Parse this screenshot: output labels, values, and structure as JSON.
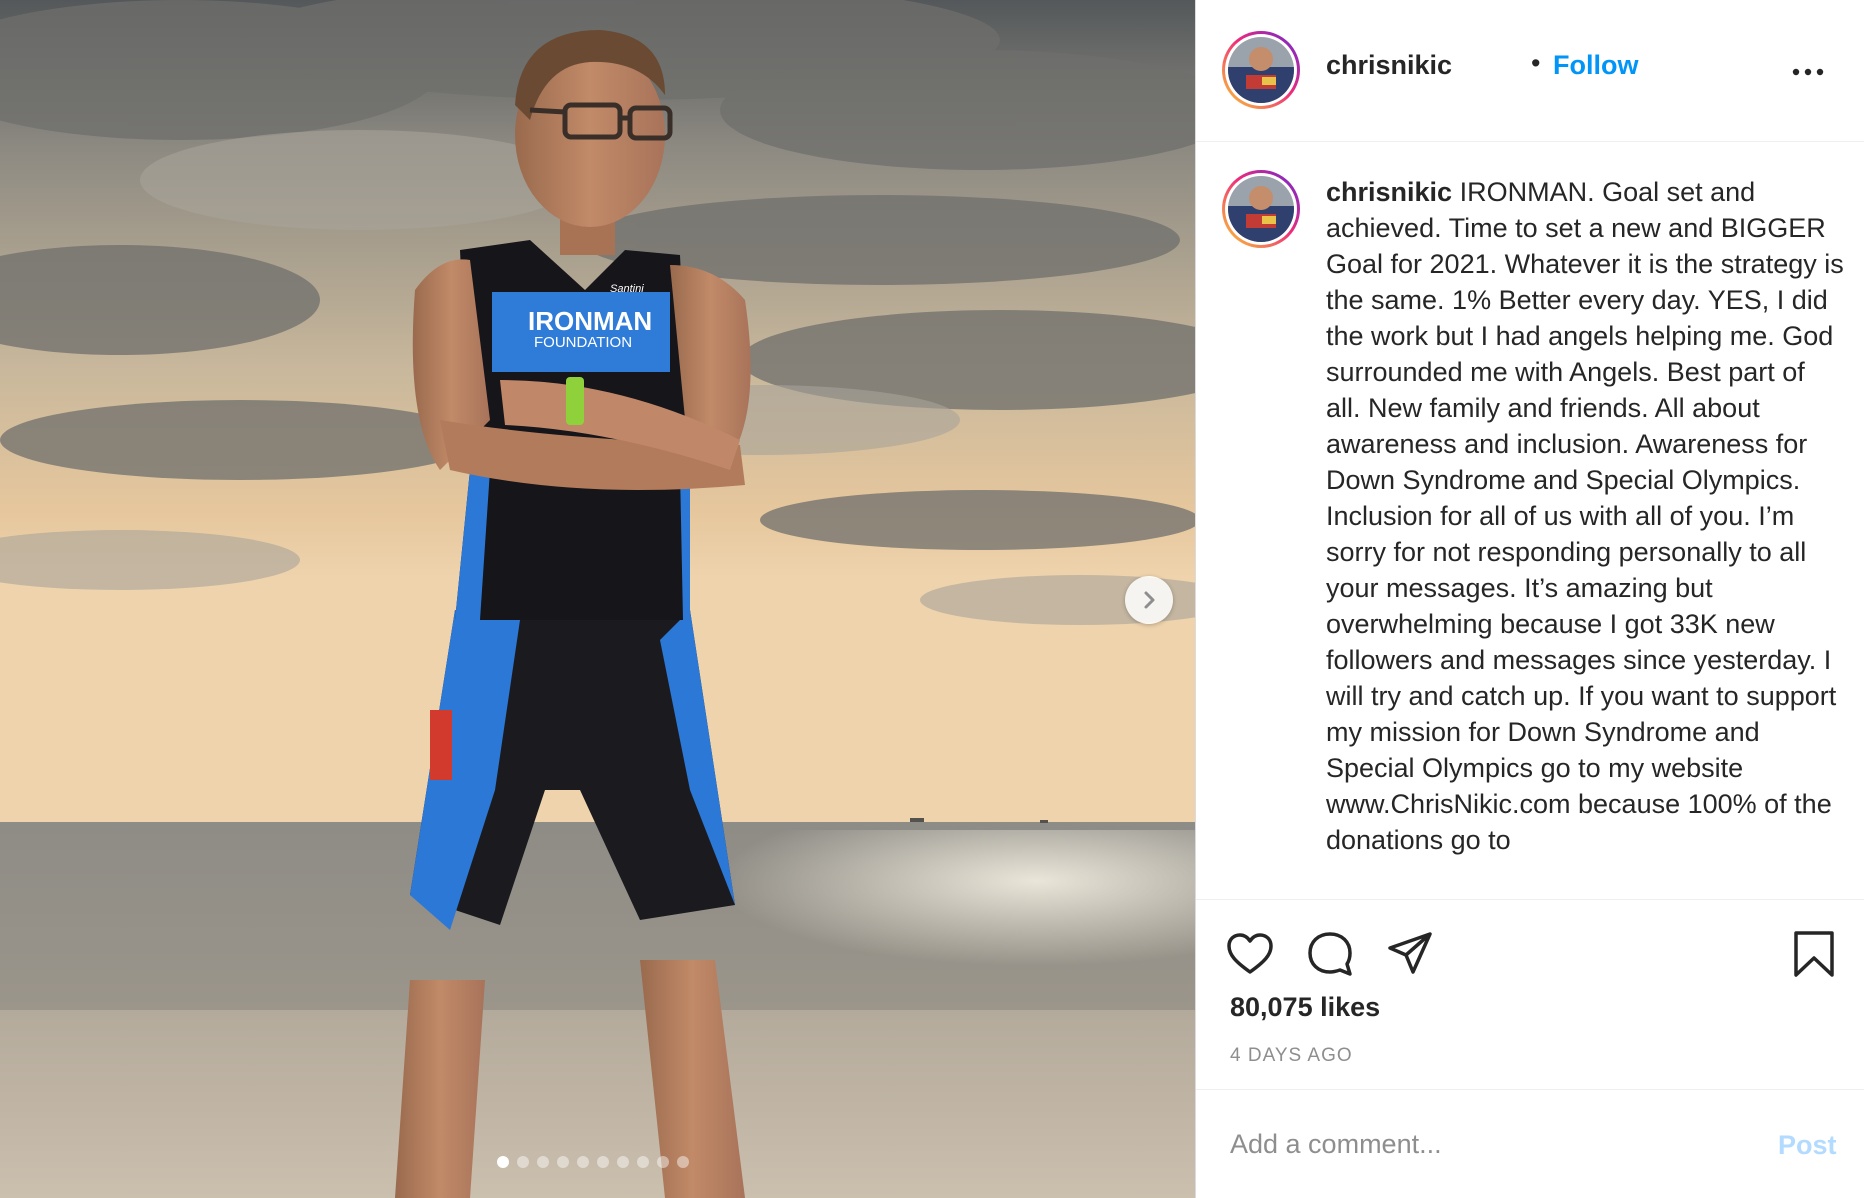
{
  "header": {
    "username": "chrisnikic",
    "separator": "•",
    "follow_label": "Follow"
  },
  "caption": {
    "username": "chrisnikic",
    "text": "IRONMAN. Goal set and achieved. Time to set a new and BIGGER Goal for 2021. Whatever it is the strategy is the same. 1% Better every day. YES, I did the work but I had angels helping me. God surrounded me with Angels. Best part of all. New family and friends. All about awareness and inclusion. Awareness for Down Syndrome and Special Olympics. Inclusion for all of us with all of you. I’m sorry for not responding personally to all your messages. It’s amazing but overwhelming because I got 33K new followers and messages since yesterday. I will try and catch up. If you want to support my mission for Down Syndrome and Special Olympics go to my website www.ChrisNikic.com because 100% of the donations go to"
  },
  "photo": {
    "jersey_brand": "IRONMAN",
    "jersey_sub": "FOUNDATION",
    "jersey_sponsor": "Santini"
  },
  "carousel": {
    "total_slides": 10,
    "active_slide": 1
  },
  "actions": {
    "likes": "80,075 likes",
    "timestamp": "4 DAYS AGO"
  },
  "comment": {
    "placeholder": "Add a comment...",
    "post_label": "Post"
  },
  "colors": {
    "link_blue": "#0095f6",
    "post_disabled": "#b3dbff",
    "muted": "#8e8e8e"
  },
  "icons": {
    "more": "more-options-icon",
    "next": "chevron-right-icon",
    "like": "heart-icon",
    "comment": "comment-icon",
    "share": "paper-plane-icon",
    "save": "bookmark-icon"
  }
}
